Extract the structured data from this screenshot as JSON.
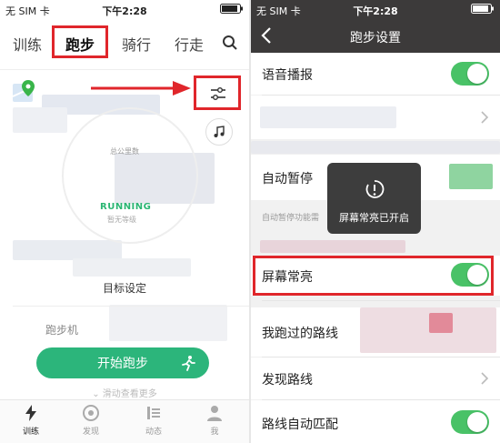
{
  "left": {
    "status": {
      "carrier": "无 SIM 卡",
      "time": "下午2:28"
    },
    "tabs": [
      {
        "label": "训练"
      },
      {
        "label": "跑步"
      },
      {
        "label": "骑行"
      },
      {
        "label": "行走"
      }
    ],
    "total_km_label": "总公里数",
    "running_label": "RUNNING",
    "level_label": "暂无等级",
    "target_label": "目标设定",
    "treadmill_label": "跑步机",
    "start_button": "开始跑步",
    "swipe_more": "滑动查看更多",
    "bottom_nav": [
      {
        "label": "训练"
      },
      {
        "label": "发现"
      },
      {
        "label": "动态"
      },
      {
        "label": "我"
      }
    ],
    "highlight_color": "#e0262b",
    "accent_color": "#2cb57b"
  },
  "right": {
    "status": {
      "carrier": "无 SIM 卡",
      "time": "下午2:28"
    },
    "title": "跑步设置",
    "rows": {
      "voice": "语音播报",
      "auto_pause": "自动暂停",
      "auto_pause_desc": "自动暂停功能需",
      "screen_on": "屏幕常亮",
      "my_routes": "我跑过的路线",
      "discover_routes": "发现路线",
      "auto_match": "路线自动匹配"
    },
    "toast": "屏幕常亮已开启",
    "toggle_color": "#49c267"
  }
}
